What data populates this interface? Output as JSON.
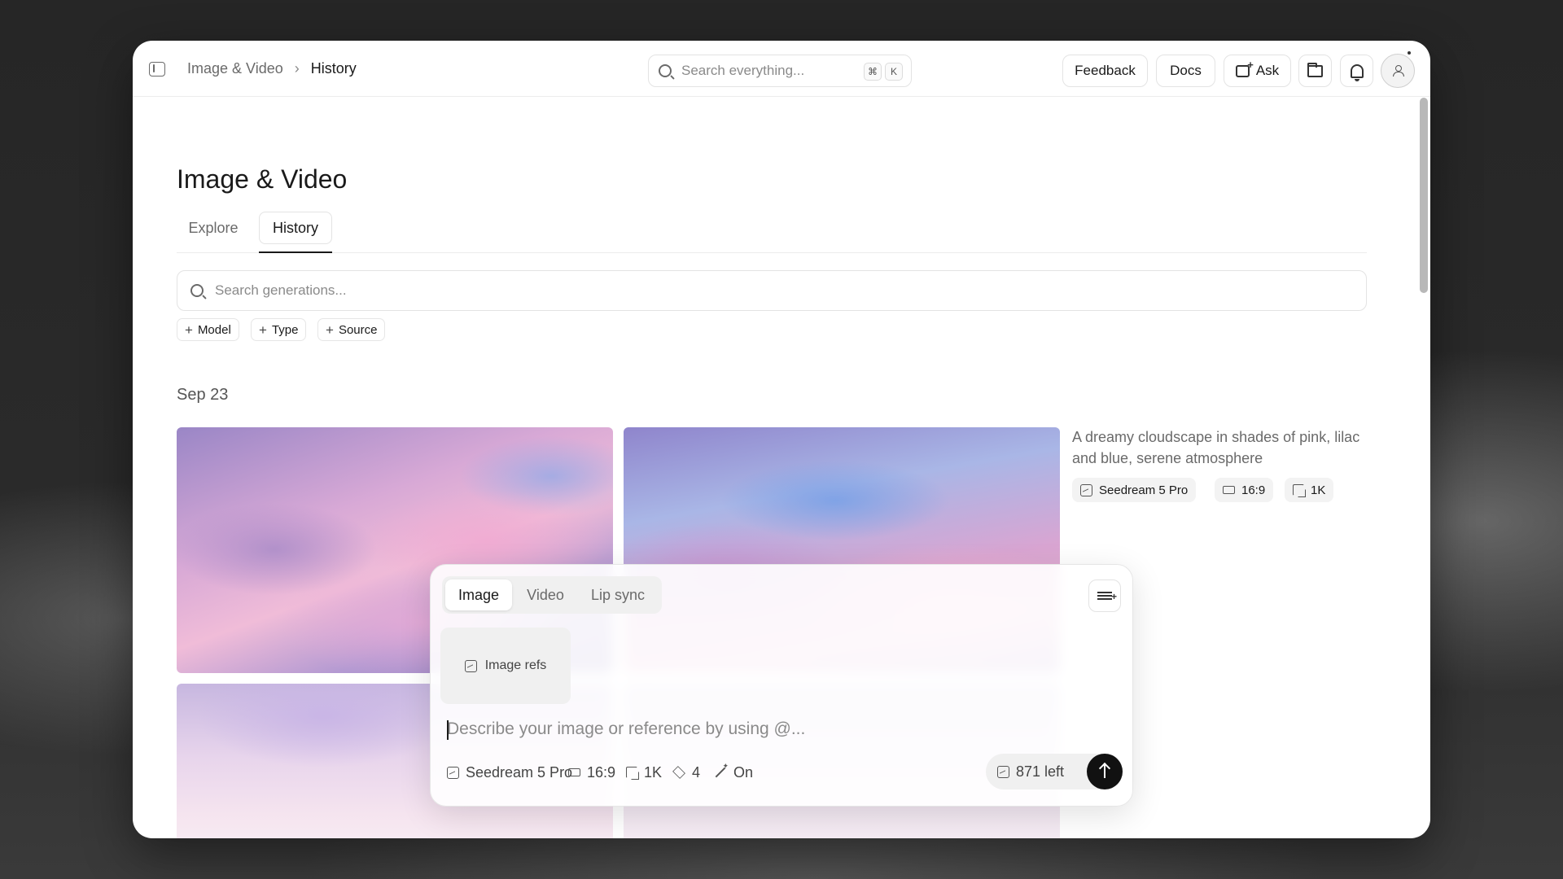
{
  "breadcrumb": {
    "parent": "Image & Video",
    "separator": "›",
    "current": "History"
  },
  "global_search": {
    "placeholder": "Search everything...",
    "shortcut_mod": "⌘",
    "shortcut_key": "K"
  },
  "toolbar": {
    "feedback": "Feedback",
    "docs": "Docs",
    "ask": "Ask"
  },
  "page": {
    "title": "Image & Video"
  },
  "tabs": [
    {
      "label": "Explore",
      "active": false
    },
    {
      "label": "History",
      "active": true
    }
  ],
  "gen_search": {
    "placeholder": "Search generations..."
  },
  "filters": [
    {
      "label": "Model"
    },
    {
      "label": "Type"
    },
    {
      "label": "Source"
    }
  ],
  "group": {
    "date": "Sep 23",
    "prompt": "A dreamy cloudscape in shades of pink, lilac and blue, serene atmosphere",
    "model": "Seedream 5 Pro",
    "ratio": "16:9",
    "resolution": "1K"
  },
  "composer": {
    "modes": [
      {
        "label": "Image",
        "active": true
      },
      {
        "label": "Video"
      },
      {
        "label": "Lip sync"
      }
    ],
    "image_refs": "Image refs",
    "placeholder": "Describe your image or reference by using @...",
    "model": "Seedream 5 Pro",
    "ratio": "16:9",
    "resolution": "1K",
    "count": "4",
    "enhance": "On",
    "credits": "871 left"
  },
  "colors": {
    "accent": "#111111",
    "window_bg": "#ffffff",
    "backdrop": "#232323"
  },
  "icons": [
    "sidebar-toggle-icon",
    "search-icon",
    "ask-icon",
    "folder-icon",
    "bell-icon",
    "avatar-icon",
    "image-icon",
    "aspect-ratio-icon",
    "resolution-icon",
    "layers-icon",
    "wand-icon",
    "sliders-icon",
    "arrow-up-icon"
  ]
}
